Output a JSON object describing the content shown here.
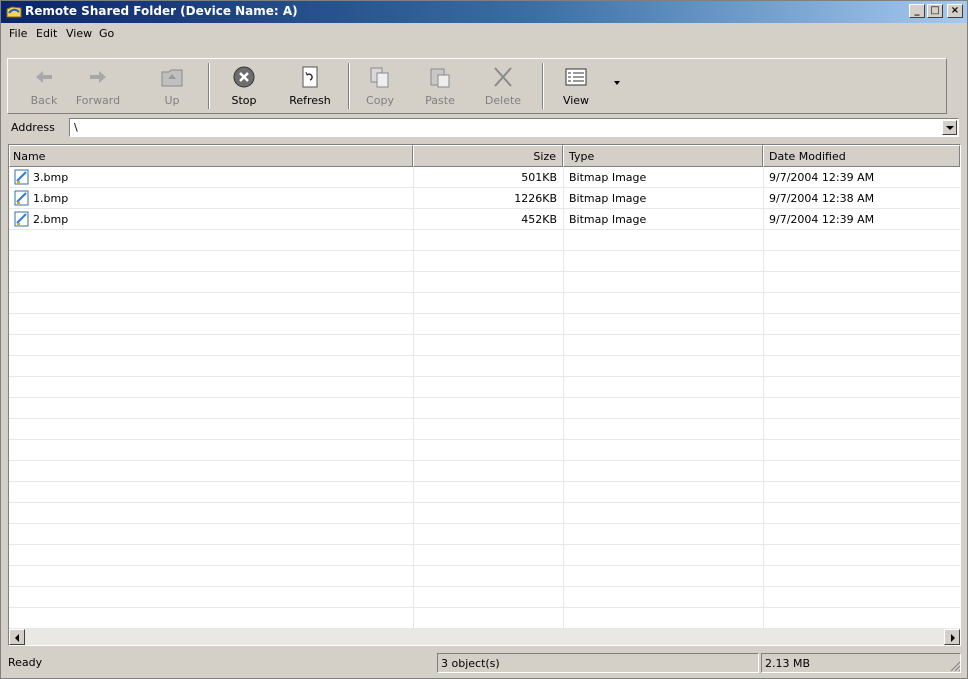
{
  "window": {
    "title": "Remote Shared Folder (Device Name: A)",
    "minimize": "_",
    "maximize": "□",
    "close": "×"
  },
  "menu": [
    "File",
    "Edit",
    "View",
    "Go"
  ],
  "toolbar": {
    "back": "Back",
    "forward": "Forward",
    "up": "Up",
    "stop": "Stop",
    "refresh": "Refresh",
    "copy": "Copy",
    "paste": "Paste",
    "delete": "Delete",
    "view": "View"
  },
  "address": {
    "label": "Address",
    "value": "\\"
  },
  "columns": [
    "Name",
    "Size",
    "Type",
    "Date Modified"
  ],
  "files": [
    {
      "name": "3.bmp",
      "size": "501KB",
      "type": "Bitmap Image",
      "date": "9/7/2004 12:39 AM"
    },
    {
      "name": "1.bmp",
      "size": "1226KB",
      "type": "Bitmap Image",
      "date": "9/7/2004 12:38 AM"
    },
    {
      "name": "2.bmp",
      "size": "452KB",
      "type": "Bitmap Image",
      "date": "9/7/2004 12:39 AM"
    }
  ],
  "status": {
    "state": "Ready",
    "objects": "3 object(s)",
    "size": "2.13 MB"
  },
  "colors": {
    "title_gradient_start": "#0a246a",
    "title_gradient_end": "#a6caf0",
    "face": "#d4d0c8"
  }
}
